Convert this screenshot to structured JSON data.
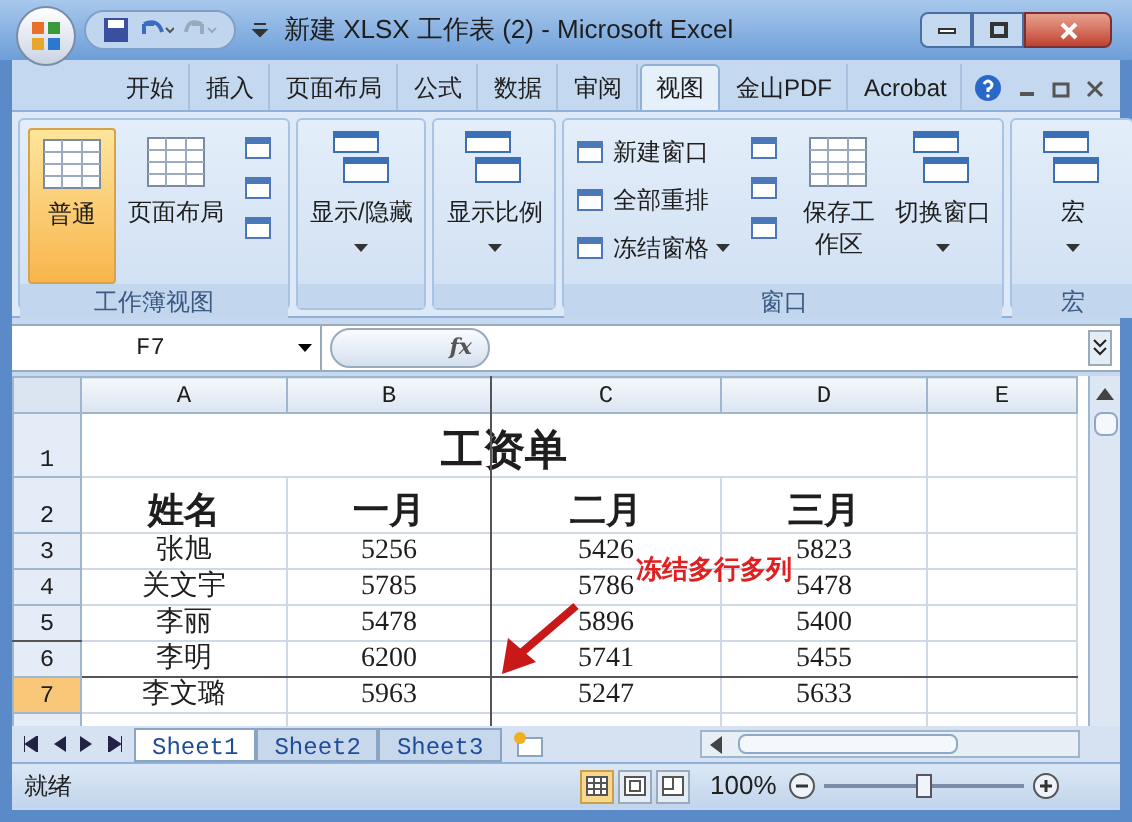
{
  "window": {
    "title": "新建 XLSX 工作表 (2) - Microsoft Excel"
  },
  "ribbon_tabs": [
    {
      "label": "开始",
      "selected": false
    },
    {
      "label": "插入",
      "selected": false
    },
    {
      "label": "页面布局",
      "selected": false
    },
    {
      "label": "公式",
      "selected": false
    },
    {
      "label": "数据",
      "selected": false
    },
    {
      "label": "审阅",
      "selected": false
    },
    {
      "label": "视图",
      "selected": true
    },
    {
      "label": "金山PDF",
      "selected": false
    },
    {
      "label": "Acrobat",
      "selected": false
    }
  ],
  "ribbon_groups": [
    {
      "title": "工作簿视图",
      "items": [
        {
          "kind": "large",
          "label": "普通",
          "selected": true
        },
        {
          "kind": "large",
          "label": "页面布局",
          "selected": false
        },
        {
          "kind": "icons"
        }
      ]
    },
    {
      "items": [
        {
          "kind": "dropdown",
          "label": "显示/隐藏"
        }
      ]
    },
    {
      "items": [
        {
          "kind": "dropdown",
          "label": "显示比例"
        }
      ]
    },
    {
      "title": "窗口",
      "items": [
        {
          "kind": "small",
          "label": "新建窗口"
        },
        {
          "kind": "small",
          "label": "全部重排"
        },
        {
          "kind": "small_dropdown",
          "label": "冻结窗格"
        },
        {
          "kind": "icons"
        },
        {
          "kind": "large_wrap",
          "label": "保存工作区",
          "selected": false
        },
        {
          "kind": "dropdown",
          "label": "切换窗口"
        }
      ]
    },
    {
      "title": "宏",
      "items": [
        {
          "kind": "dropdown",
          "label": "宏"
        }
      ]
    }
  ],
  "formula_bar": {
    "name_box": "F7",
    "function_label": "fx"
  },
  "sheet": {
    "columns": [
      "A",
      "B",
      "C",
      "D",
      "E"
    ],
    "rows": [
      {
        "number": "1",
        "selected": false,
        "kind": "title",
        "cells": [
          {
            "text": "工资单",
            "colspan": 4
          }
        ]
      },
      {
        "number": "2",
        "selected": false,
        "kind": "header",
        "cells": [
          "姓名",
          "一月",
          "二月",
          "三月"
        ]
      },
      {
        "number": "3",
        "selected": false,
        "kind": "data",
        "cells": [
          "张旭",
          "5256",
          "5426",
          "5823"
        ]
      },
      {
        "number": "4",
        "selected": false,
        "kind": "data",
        "cells": [
          "关文宇",
          "5785",
          "5786",
          "5478"
        ]
      },
      {
        "number": "5",
        "selected": false,
        "kind": "data",
        "cells": [
          "李丽",
          "5478",
          "5896",
          "5400"
        ]
      },
      {
        "number": "6",
        "selected": false,
        "kind": "data",
        "cells": [
          "李明",
          "6200",
          "5741",
          "5455"
        ]
      },
      {
        "number": "7",
        "selected": true,
        "kind": "data",
        "cells": [
          "李文璐",
          "5963",
          "5247",
          "5633"
        ]
      }
    ]
  },
  "annotation": {
    "text": "冻结多行多列"
  },
  "sheet_tabs": [
    {
      "label": "Sheet1",
      "selected": true
    },
    {
      "label": "Sheet2",
      "selected": false
    },
    {
      "label": "Sheet3",
      "selected": false
    }
  ],
  "status_bar": {
    "status": "就绪",
    "views": [
      {
        "kind": "normal",
        "selected": true
      },
      {
        "kind": "layout",
        "selected": false
      },
      {
        "kind": "break",
        "selected": false
      }
    ],
    "zoom": "100%",
    "zoom_slider": {
      "level": 0.5
    }
  }
}
